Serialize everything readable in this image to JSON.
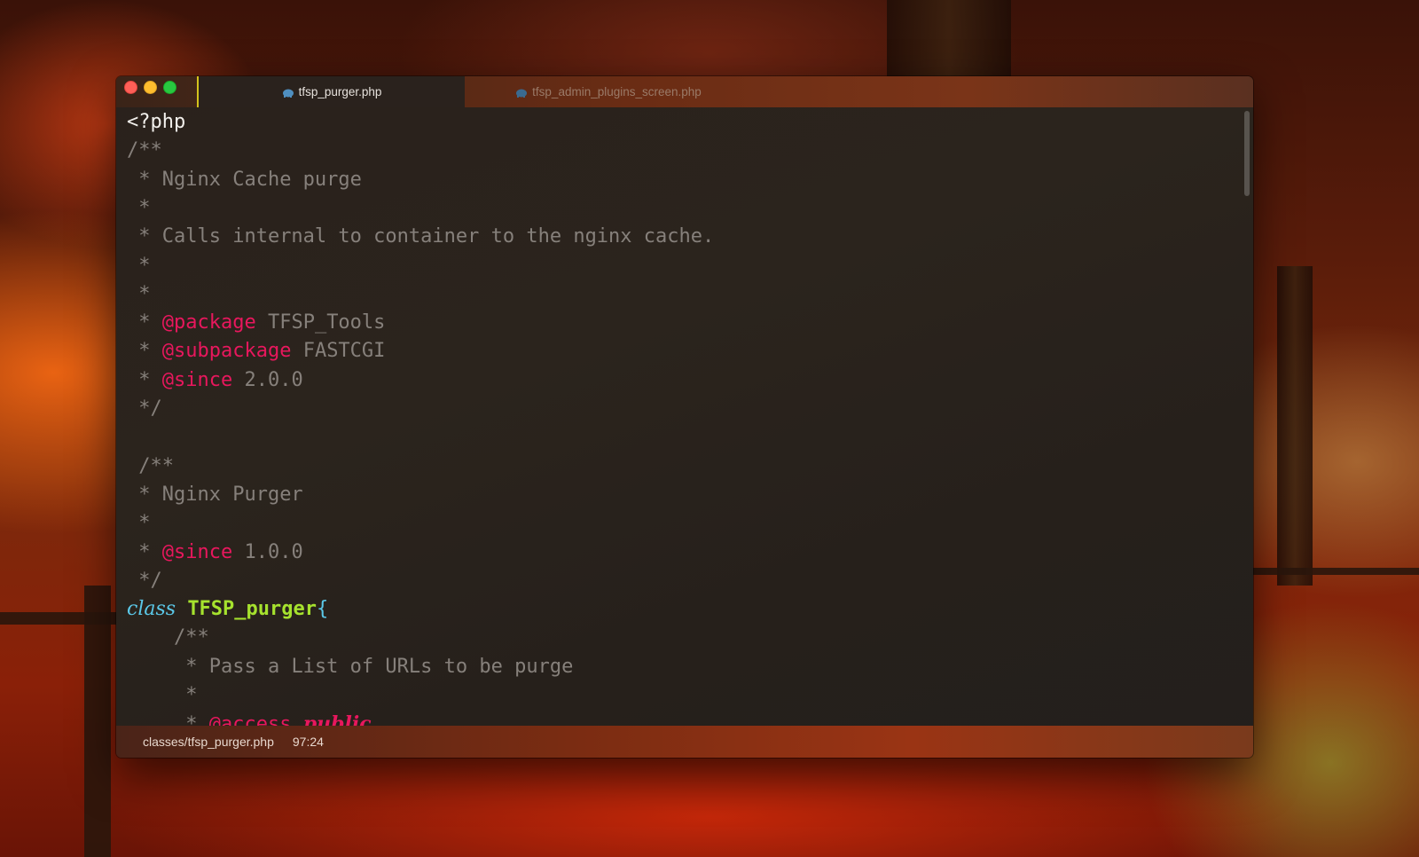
{
  "window": {
    "tabs": [
      {
        "label": "tfsp_purger.php",
        "icon": "php-elephant-icon",
        "active": true
      },
      {
        "label": "tfsp_admin_plugins_screen.php",
        "icon": "php-elephant-icon",
        "active": false
      }
    ]
  },
  "editor": {
    "lines": [
      {
        "indent": "",
        "tokens": [
          {
            "t": "plain",
            "v": "<?php"
          }
        ]
      },
      {
        "indent": "",
        "tokens": [
          {
            "t": "comment",
            "v": "/**"
          }
        ]
      },
      {
        "indent": " ",
        "tokens": [
          {
            "t": "comment",
            "v": "* Nginx Cache purge"
          }
        ]
      },
      {
        "indent": " ",
        "tokens": [
          {
            "t": "comment",
            "v": "*"
          }
        ]
      },
      {
        "indent": " ",
        "tokens": [
          {
            "t": "comment",
            "v": "* Calls internal to container to the nginx cache."
          }
        ]
      },
      {
        "indent": " ",
        "tokens": [
          {
            "t": "comment",
            "v": "*"
          }
        ]
      },
      {
        "indent": " ",
        "tokens": [
          {
            "t": "comment",
            "v": "*"
          }
        ]
      },
      {
        "indent": " ",
        "tokens": [
          {
            "t": "comment",
            "v": "* "
          },
          {
            "t": "tag",
            "v": "@package"
          },
          {
            "t": "comment",
            "v": " TFSP_Tools"
          }
        ]
      },
      {
        "indent": " ",
        "tokens": [
          {
            "t": "comment",
            "v": "* "
          },
          {
            "t": "tag",
            "v": "@subpackage"
          },
          {
            "t": "comment",
            "v": " FASTCGI"
          }
        ]
      },
      {
        "indent": " ",
        "tokens": [
          {
            "t": "comment",
            "v": "* "
          },
          {
            "t": "tag",
            "v": "@since"
          },
          {
            "t": "comment",
            "v": " 2.0.0"
          }
        ]
      },
      {
        "indent": " ",
        "tokens": [
          {
            "t": "comment",
            "v": "*/"
          }
        ]
      },
      {
        "indent": "",
        "tokens": []
      },
      {
        "indent": " ",
        "tokens": [
          {
            "t": "comment",
            "v": "/**"
          }
        ]
      },
      {
        "indent": " ",
        "tokens": [
          {
            "t": "comment",
            "v": "* Nginx Purger"
          }
        ]
      },
      {
        "indent": " ",
        "tokens": [
          {
            "t": "comment",
            "v": "*"
          }
        ]
      },
      {
        "indent": " ",
        "tokens": [
          {
            "t": "comment",
            "v": "* "
          },
          {
            "t": "tag",
            "v": "@since"
          },
          {
            "t": "comment",
            "v": " 1.0.0"
          }
        ]
      },
      {
        "indent": " ",
        "tokens": [
          {
            "t": "comment",
            "v": "*/"
          }
        ]
      },
      {
        "indent": "",
        "tokens": [
          {
            "t": "keyword",
            "v": "class"
          },
          {
            "t": "plain",
            "v": " "
          },
          {
            "t": "classname",
            "v": "TFSP_purger"
          },
          {
            "t": "brace",
            "v": "{"
          }
        ]
      },
      {
        "indent": "    ",
        "tokens": [
          {
            "t": "comment",
            "v": "/**"
          }
        ]
      },
      {
        "indent": "     ",
        "tokens": [
          {
            "t": "comment",
            "v": "* Pass a List of URLs to be purge"
          }
        ]
      },
      {
        "indent": "     ",
        "tokens": [
          {
            "t": "comment",
            "v": "*"
          }
        ]
      },
      {
        "indent": "     ",
        "tokens": [
          {
            "t": "comment",
            "v": "* "
          },
          {
            "t": "tag",
            "v": "@access"
          },
          {
            "t": "comment",
            "v": " "
          },
          {
            "t": "keyword-pink",
            "v": "public"
          }
        ]
      }
    ]
  },
  "statusbar": {
    "file_path": "classes/tfsp_purger.php",
    "cursor_position": "97:24"
  },
  "colors": {
    "comment": "#86807b",
    "doc_tag": "#e8175d",
    "keyword": "#5bc8e8",
    "class_name": "#a6e22e",
    "active_tab_accent": "#d4c21c"
  }
}
